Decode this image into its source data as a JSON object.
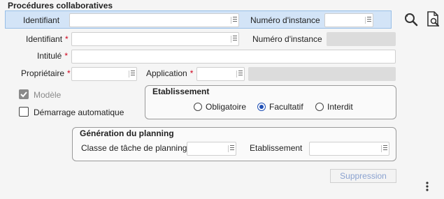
{
  "page": {
    "title": "Procédures collaboratives"
  },
  "search": {
    "identifiant_label": "Identifiant",
    "identifiant_value": "",
    "instance_label": "Numéro d'instance",
    "instance_value": ""
  },
  "toolbar": {
    "search_icon": "search-reset-icon",
    "doc_search_icon": "document-search-icon"
  },
  "form": {
    "identifiant_label": "Identifiant",
    "identifiant_value": "",
    "instance_label": "Numéro d'instance",
    "intitule_label": "Intitulé",
    "intitule_value": "",
    "proprietaire_label": "Propriétaire",
    "proprietaire_value": "",
    "application_label": "Application",
    "application_value": "",
    "required_mark": "*"
  },
  "options": {
    "modele_label": "Modèle",
    "modele_checked": true,
    "demarrage_label": "Démarrage automatique",
    "demarrage_checked": false
  },
  "etablissement": {
    "title": "Etablissement",
    "options": [
      "Obligatoire",
      "Facultatif",
      "Interdit"
    ],
    "selected": "Facultatif"
  },
  "planning": {
    "title": "Génération du planning",
    "classe_label": "Classe de tâche de planning",
    "classe_value": "",
    "etab_label": "Etablissement",
    "etab_value": ""
  },
  "actions": {
    "suppression_label": "Suppression"
  },
  "colors": {
    "accent": "#1f4fb5",
    "search_bg": "#d3e4f7",
    "required": "#d0021b"
  }
}
